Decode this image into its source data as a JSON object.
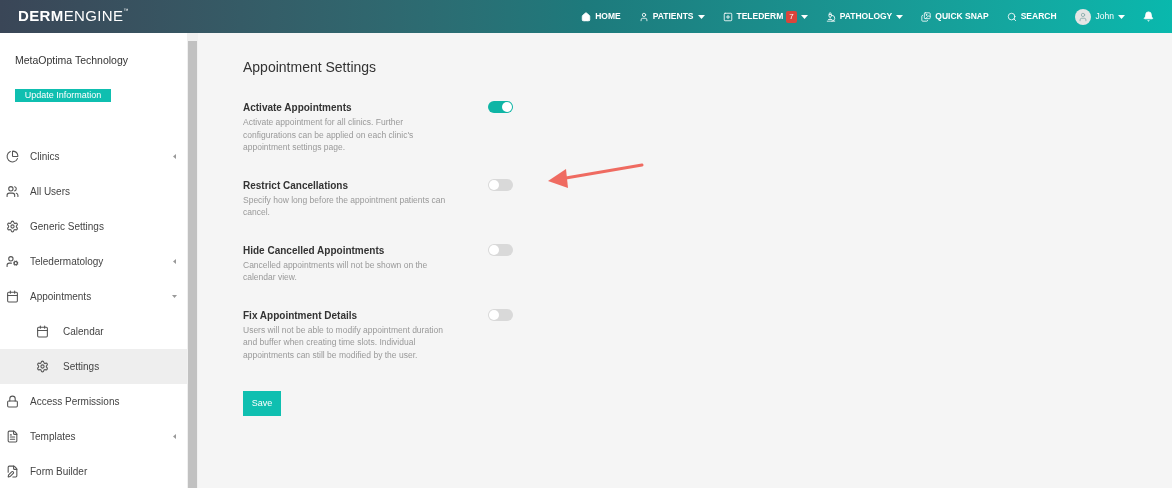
{
  "logo": {
    "bold": "DERM",
    "light": "ENGINE",
    "mark": "™"
  },
  "nav": [
    {
      "kind": "home",
      "label": "HOME",
      "dropdown": false
    },
    {
      "kind": "patients",
      "label": "PATIENTS",
      "dropdown": true
    },
    {
      "kind": "telederm",
      "label": "TELEDERM",
      "badge": "7",
      "dropdown": true
    },
    {
      "kind": "pathology",
      "label": "PATHOLOGY",
      "dropdown": true
    },
    {
      "kind": "snap",
      "label": "QUICK SNAP",
      "dropdown": false
    },
    {
      "kind": "search",
      "label": "SEARCH",
      "dropdown": false
    },
    {
      "kind": "user",
      "label": "John",
      "dropdown": true
    }
  ],
  "sidebar": {
    "org": "MetaOptima Technology",
    "button": "Update Information",
    "items": [
      {
        "kind": "pie",
        "label": "Clinics",
        "selected": false,
        "expandable": true,
        "expanded": false
      },
      {
        "kind": "users",
        "label": "All Users",
        "selected": false,
        "expandable": false
      },
      {
        "kind": "gear",
        "label": "Generic Settings",
        "selected": false,
        "expandable": false
      },
      {
        "kind": "doctor",
        "label": "Teledermatology",
        "selected": false,
        "expandable": true,
        "expanded": false
      },
      {
        "kind": "calendar",
        "label": "Appointments",
        "selected": false,
        "expandable": true,
        "expanded": true,
        "children": [
          {
            "kind": "calendar",
            "label": "Calendar",
            "selected": false
          },
          {
            "kind": "gear",
            "label": "Settings",
            "selected": true
          }
        ]
      },
      {
        "kind": "lock",
        "label": "Access Permissions",
        "selected": false,
        "expandable": false
      },
      {
        "kind": "doc",
        "label": "Templates",
        "selected": false,
        "expandable": true,
        "expanded": false
      },
      {
        "kind": "form",
        "label": "Form Builder",
        "selected": false,
        "expandable": false
      }
    ]
  },
  "title": "Appointment Settings",
  "settings": [
    {
      "label": "Activate Appointments",
      "description": "Activate appointment for all clinics. Further configurations can be applied on each clinic's appointment settings page.",
      "on": true
    },
    {
      "label": "Restrict Cancellations",
      "description": "Specify how long before the appointment patients can cancel.",
      "on": false
    },
    {
      "label": "Hide Cancelled Appointments",
      "description": "Cancelled appointments will not be shown on the calendar view.",
      "on": false
    },
    {
      "label": "Fix Appointment Details",
      "description": "Users will not be able to modify appointment duration and buffer when creating time slots. Individual appointments can still be modified by the user.",
      "on": false
    }
  ],
  "save": "Save"
}
